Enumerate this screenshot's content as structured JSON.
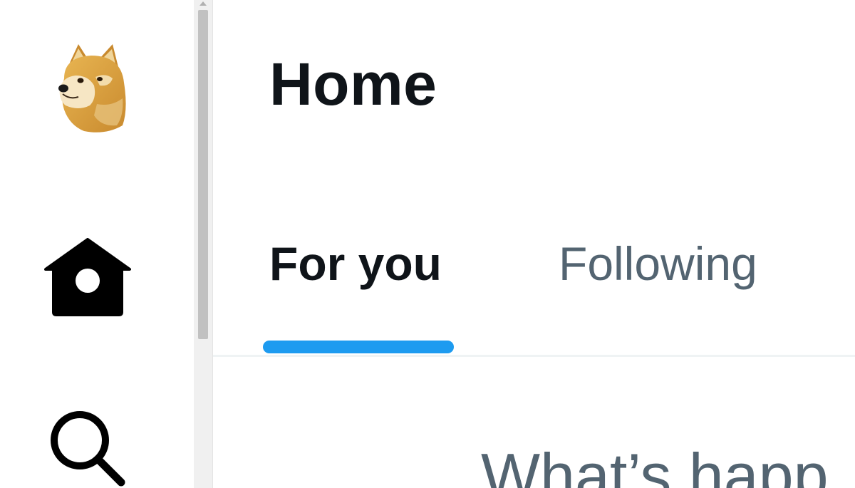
{
  "app": {
    "logo_icon": "doge-logo-icon"
  },
  "nav": {
    "items": [
      {
        "icon": "home-icon",
        "active": true
      },
      {
        "icon": "search-icon",
        "active": false
      }
    ]
  },
  "header": {
    "title": "Home"
  },
  "tabs": [
    {
      "label": "For you",
      "selected": true
    },
    {
      "label": "Following",
      "selected": false
    }
  ],
  "composer": {
    "placeholder": "What’s happ"
  },
  "colors": {
    "accent": "#1d9bf0",
    "text_primary": "#0f1419",
    "text_secondary": "#536471",
    "divider": "#eff3f4"
  }
}
